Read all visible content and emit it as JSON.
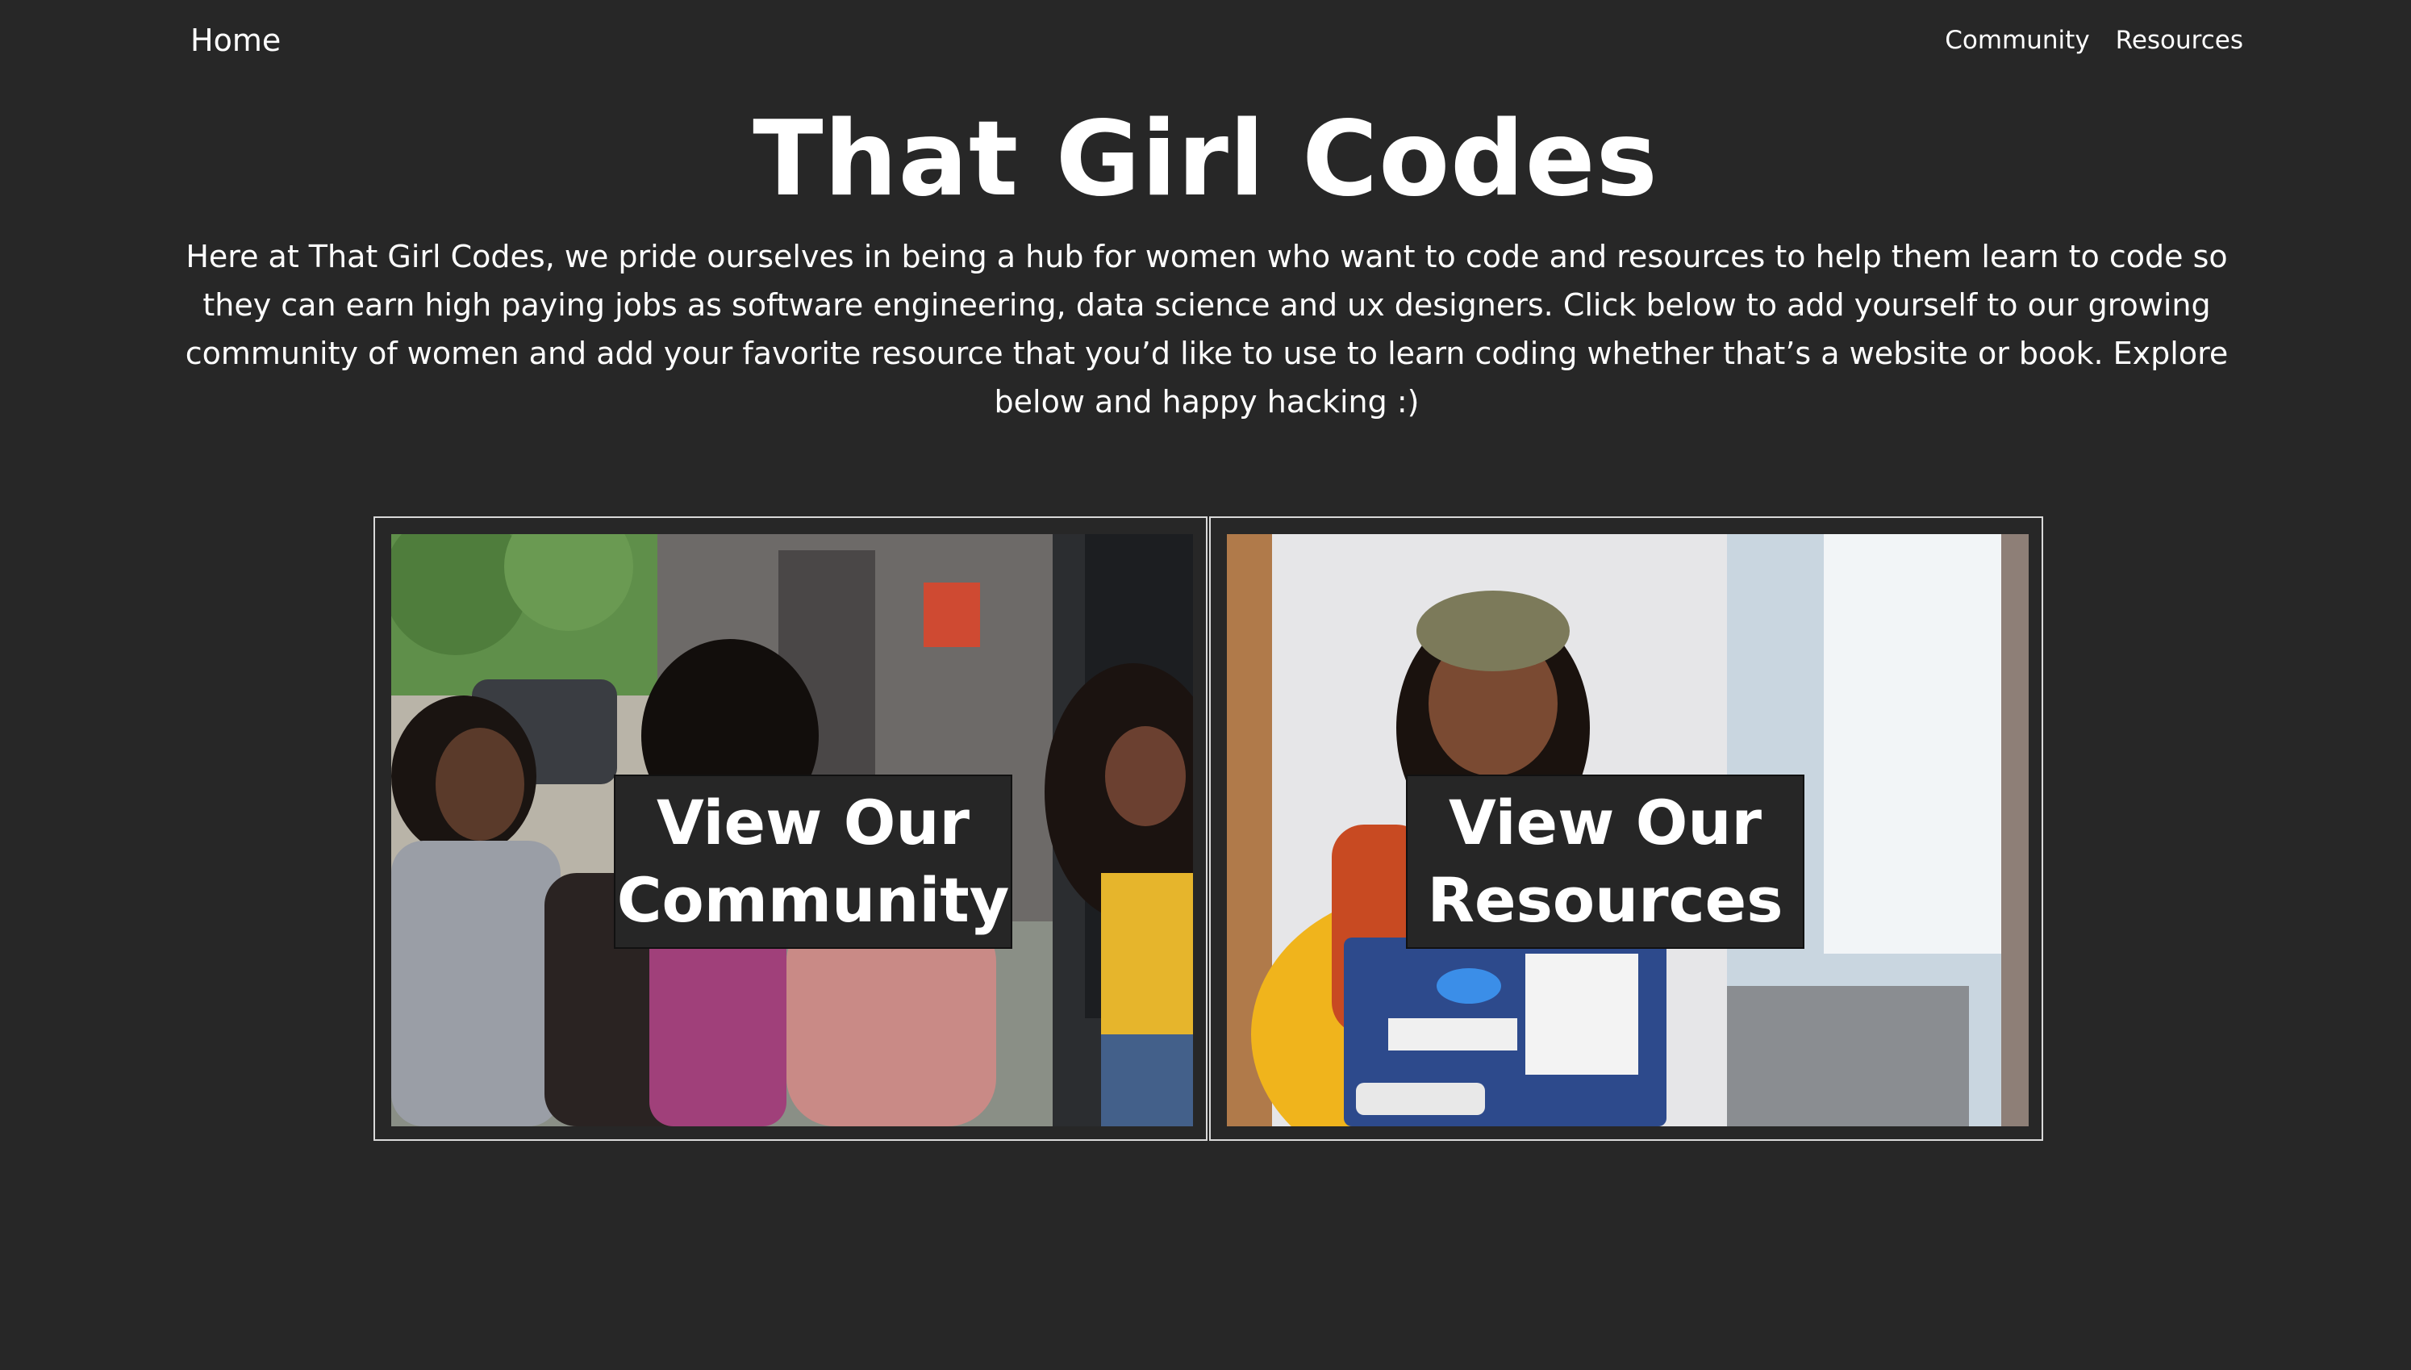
{
  "nav": {
    "home_label": "Home",
    "links": [
      "Community",
      "Resources"
    ]
  },
  "header": {
    "title": "That Girl Codes",
    "intro": "Here at That Girl Codes, we pride ourselves in being a hub for women who want to code and resources to help them learn to code so they can earn high paying jobs as software engineering, data science and ux designers. Click below to add yourself to our growing community of women and add your favorite resource that you’d like to use to learn coding whether that’s a website or book. Explore below and happy hacking :)"
  },
  "cards": [
    {
      "label_line1": "View Our",
      "label_line2": "Community",
      "image": "group-of-women-photo"
    },
    {
      "label_line1": "View Our",
      "label_line2": "Resources",
      "image": "woman-with-laptop-photo"
    }
  ],
  "colors": {
    "background": "#272727",
    "text": "#ffffff",
    "card_border": "#d9d9d9",
    "label_bg": "#262626"
  }
}
